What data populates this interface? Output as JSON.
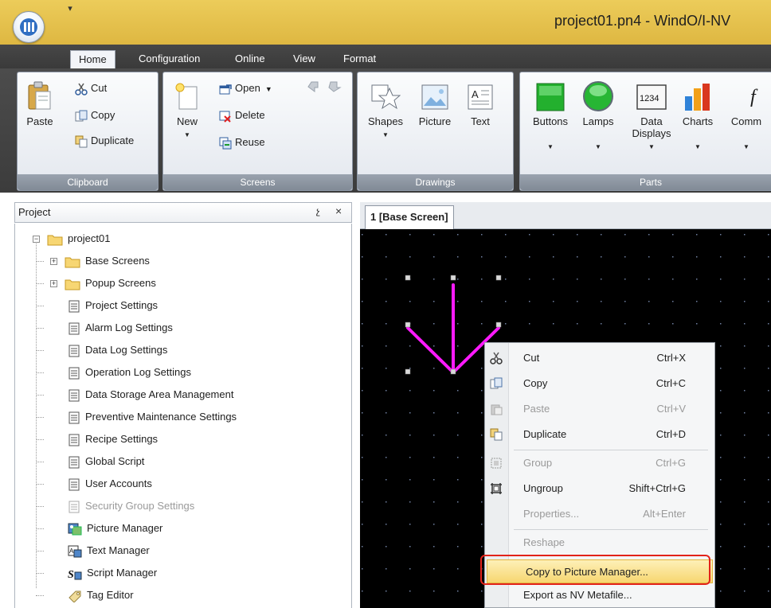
{
  "window": {
    "title": "project01.pn4 - WindO/I-NV"
  },
  "ribbon": {
    "tabs": [
      "Home",
      "Configuration",
      "Online",
      "View",
      "Format"
    ],
    "groups": {
      "clipboard": {
        "label": "Clipboard",
        "paste": "Paste",
        "cut": "Cut",
        "copy": "Copy",
        "duplicate": "Duplicate"
      },
      "screens": {
        "label": "Screens",
        "new": "New",
        "open": "Open",
        "delete": "Delete",
        "reuse": "Reuse"
      },
      "drawings": {
        "label": "Drawings",
        "shapes": "Shapes",
        "picture": "Picture",
        "text": "Text"
      },
      "parts": {
        "label": "Parts",
        "buttons": "Buttons",
        "lamps": "Lamps",
        "data_displays_1": "Data",
        "data_displays_2": "Displays",
        "data_display_sample": "1234",
        "charts": "Charts",
        "commands": "Comm"
      }
    }
  },
  "project_panel": {
    "title": "Project",
    "pin": "չ",
    "close": "×",
    "items": [
      {
        "label": "project01"
      },
      {
        "label": "Base Screens"
      },
      {
        "label": "Popup Screens"
      },
      {
        "label": "Project Settings"
      },
      {
        "label": "Alarm Log Settings"
      },
      {
        "label": "Data Log Settings"
      },
      {
        "label": "Operation Log Settings"
      },
      {
        "label": "Data Storage Area Management"
      },
      {
        "label": "Preventive Maintenance Settings"
      },
      {
        "label": "Recipe Settings"
      },
      {
        "label": "Global Script"
      },
      {
        "label": "User Accounts"
      },
      {
        "label": "Security Group Settings"
      },
      {
        "label": "Picture Manager"
      },
      {
        "label": "Text Manager"
      },
      {
        "label": "Script Manager"
      },
      {
        "label": "Tag Editor"
      }
    ]
  },
  "screen_tab": {
    "label": "1 [Base Screen]"
  },
  "context_menu": {
    "items": [
      {
        "label": "Cut",
        "shortcut": "Ctrl+X"
      },
      {
        "label": "Copy",
        "shortcut": "Ctrl+C"
      },
      {
        "label": "Paste",
        "shortcut": "Ctrl+V"
      },
      {
        "label": "Duplicate",
        "shortcut": "Ctrl+D"
      },
      {
        "label": "Group",
        "shortcut": "Ctrl+G"
      },
      {
        "label": "Ungroup",
        "shortcut": "Shift+Ctrl+G"
      },
      {
        "label": "Properties...",
        "shortcut": "Alt+Enter"
      },
      {
        "label": "Reshape",
        "shortcut": ""
      },
      {
        "label": "Copy to Picture Manager...",
        "shortcut": ""
      },
      {
        "label": "Export as NV Metafile...",
        "shortcut": ""
      }
    ]
  },
  "colors": {
    "accent": "#e6c65a",
    "highlight_ring": "#e2231a",
    "shape_stroke": "#ff1aff",
    "canvas": "#000000"
  }
}
